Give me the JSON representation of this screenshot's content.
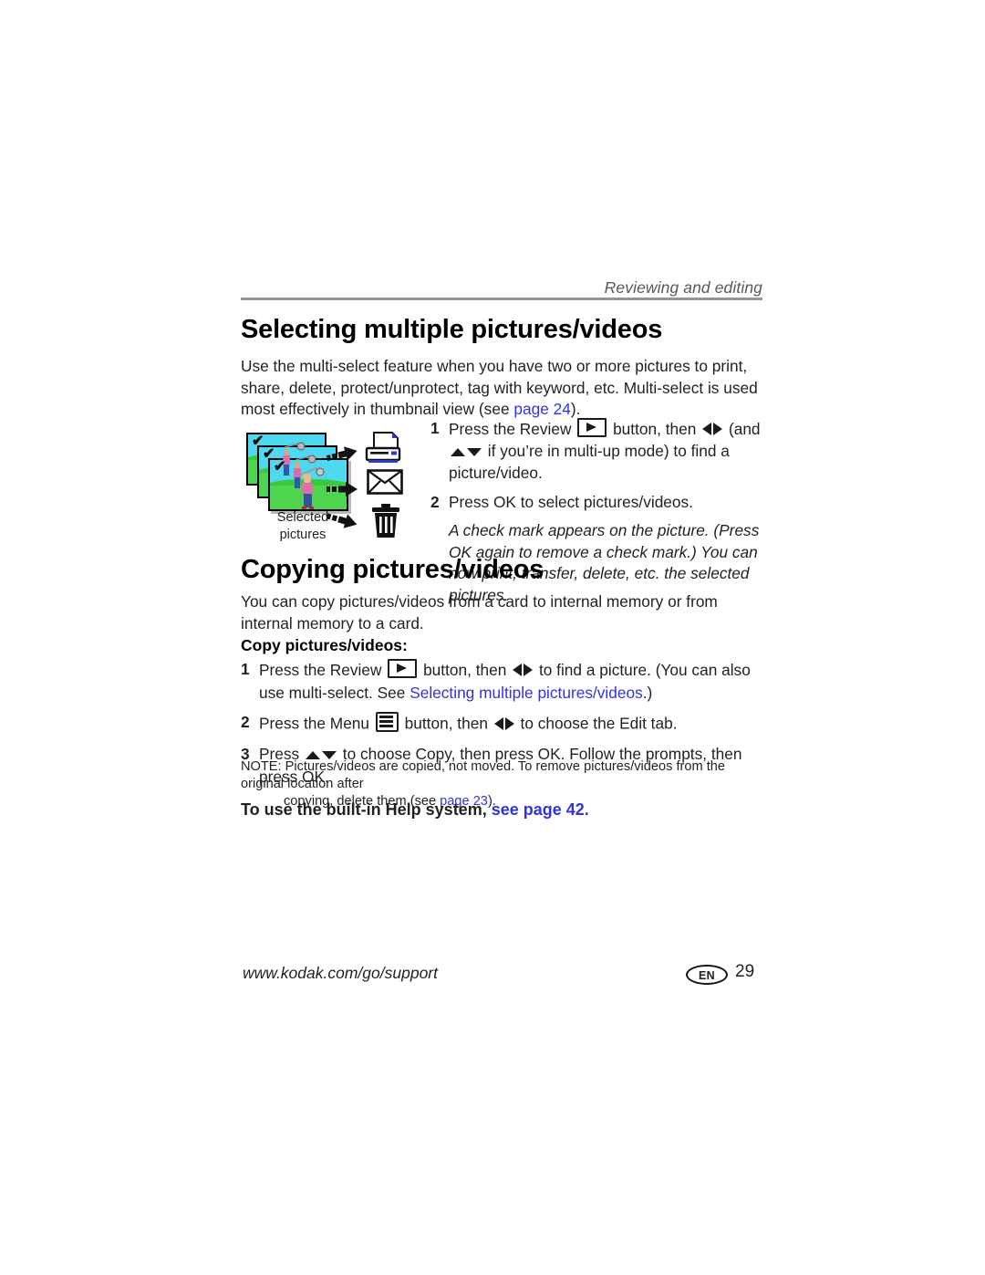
{
  "page": {
    "running_head": "Reviewing and editing",
    "footer_url": "www.kodak.com/go/support",
    "footer_language_badge": "EN",
    "footer_page_number": "29",
    "link_color": "#3333dd",
    "rule_color": "#939598"
  },
  "section_select": {
    "heading": "Selecting multiple pictures/videos",
    "intro_a": "Use the multi-select feature when you have two or more pictures to print, share, delete, protect/unprotect, tag with keyword, etc. Multi-select is used most effectively in thumbnail view (see ",
    "intro_link": "page 24",
    "intro_b": ").",
    "steps": [
      {
        "num": "1",
        "a": "Press the Review ",
        "icon": "review-button-icon",
        "b": " button, then ",
        "c": " (and ",
        "d": " if you’re in multi-up mode) to find a picture/video."
      },
      {
        "num": "2",
        "a": "Press OK to select pictures/videos.",
        "note": "A check mark appears on the picture. (Press OK again to remove a check mark.) You can now print, transfer, delete, etc. the selected pictures."
      }
    ],
    "illustration": {
      "caption_line1": "Selected",
      "caption_line2": "pictures",
      "photo_count": 3,
      "check_glyph": "✔",
      "targets": [
        "printer-icon",
        "envelope-icon",
        "trash-icon"
      ]
    }
  },
  "section_copy": {
    "heading": "Copying pictures/videos",
    "intro": "You can copy pictures/videos from a card to internal memory or from internal memory to a card.",
    "subhead": "Copy pictures/videos:",
    "steps": [
      {
        "num": "1",
        "a": "Press the Review ",
        "b": " button, then ",
        "c": " to find a picture. (You can also use multi-select. See ",
        "link": "Selecting multiple pictures/videos",
        "d": ".)"
      },
      {
        "num": "2",
        "a": "Press the Menu ",
        "b": " button, then ",
        "c": " to choose the Edit tab."
      },
      {
        "num": "3",
        "a": "Press ",
        "b": " to choose Copy, then press OK. Follow the prompts, then press OK."
      }
    ],
    "note": {
      "label": "NOTE:",
      "line_a": "Pictures/videos are copied, not moved. To remove pictures/videos from the original location after",
      "line_b_pre": "copying, delete them (see ",
      "line_b_link": "page 23",
      "line_b_post": ")."
    },
    "help_pre": "To use the built-in Help system, ",
    "help_link": "see page 42."
  }
}
